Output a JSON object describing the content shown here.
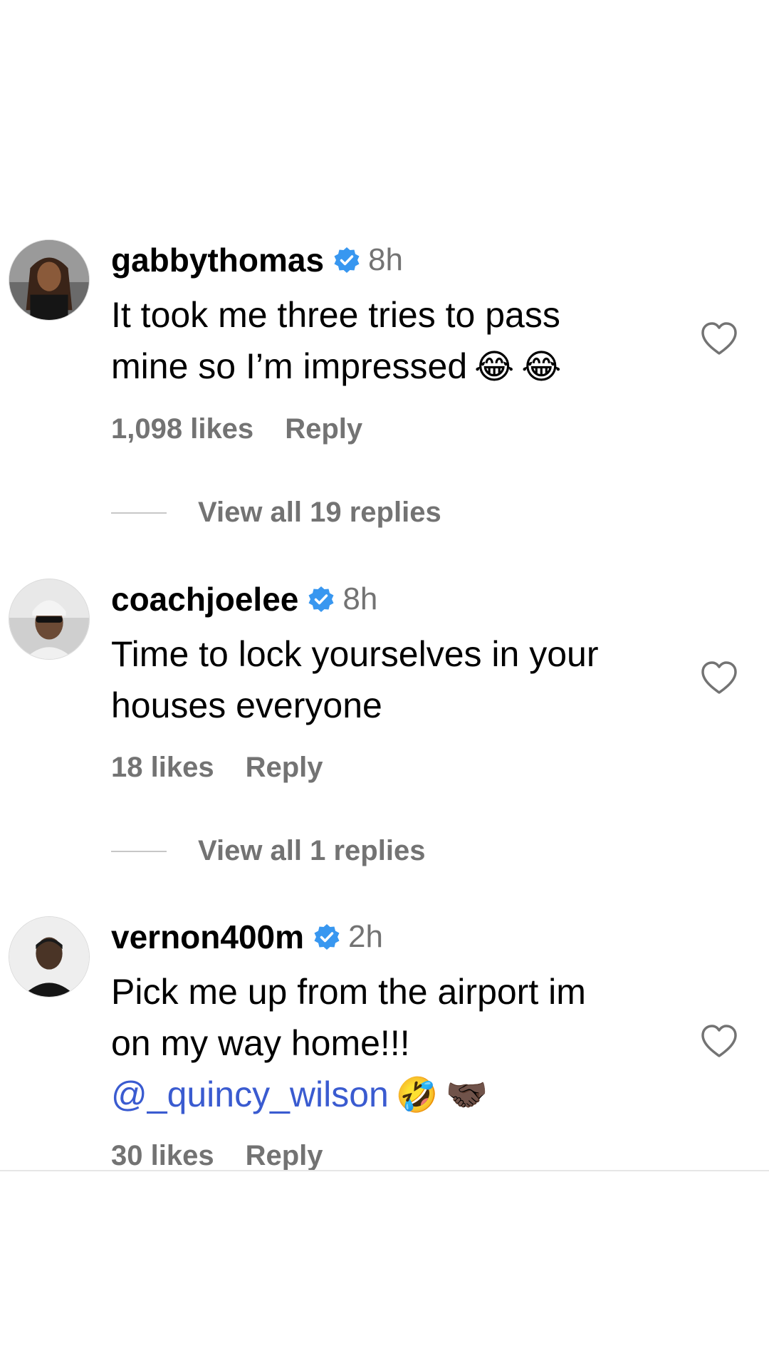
{
  "comments": [
    {
      "username": "gabbythomas",
      "time": "8h",
      "lines": [
        "It took me three tries to pass",
        "mine so I’m impressed"
      ],
      "emojis": [
        "😂",
        "😂"
      ],
      "likes": "1,098 likes",
      "reply": "Reply",
      "view_replies": "View all 19 replies"
    },
    {
      "username": "coachjoelee",
      "time": "8h",
      "lines": [
        "Time to lock yourselves in your",
        "houses everyone"
      ],
      "likes": "18 likes",
      "reply": "Reply",
      "view_replies": "View all 1 replies"
    },
    {
      "username": "vernon400m",
      "time": "2h",
      "lines": [
        "Pick me up from the airport im",
        "on my way home!!!"
      ],
      "mention": "@_quincy_wilson",
      "emojis": [
        "🤣",
        "🤝🏿"
      ],
      "likes": "30 likes",
      "reply": "Reply"
    }
  ],
  "icons": {
    "verified": "verified-badge-icon",
    "like": "heart-outline-icon"
  },
  "colors": {
    "verified": "#3897f0",
    "secondary_text": "#737373",
    "mention": "#3a5bd0"
  }
}
